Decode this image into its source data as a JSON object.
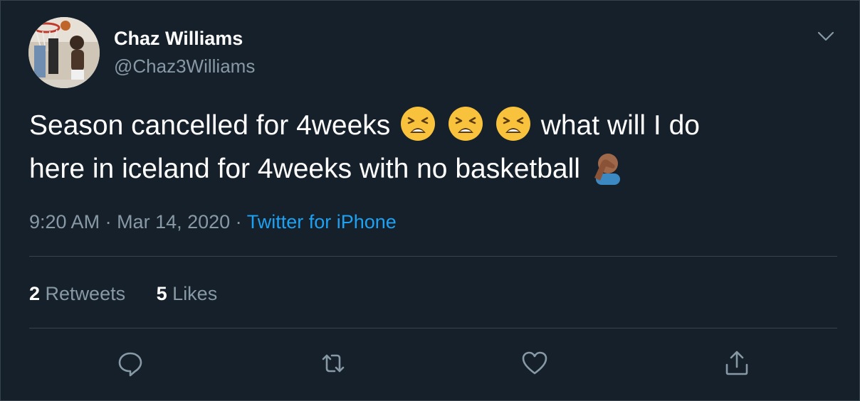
{
  "author": {
    "display_name": "Chaz Williams",
    "handle": "@Chaz3Williams",
    "avatar_icon": "avatar-photo"
  },
  "tweet": {
    "line1_part1": "Season cancelled for 4weeks",
    "line1_part2": "what will I do",
    "line2_part1": "here in iceland for 4weeks with no basketball",
    "emojis": [
      "weary-face-emoji",
      "weary-face-emoji",
      "weary-face-emoji",
      "face-palm-emoji"
    ]
  },
  "meta": {
    "time": "9:20 AM",
    "separator": " · ",
    "date": "Mar 14, 2020",
    "source": "Twitter for iPhone"
  },
  "stats": {
    "retweets_count": "2",
    "retweets_label": "Retweets",
    "likes_count": "5",
    "likes_label": "Likes"
  },
  "actions": [
    "reply-icon",
    "retweet-icon",
    "like-icon",
    "share-icon"
  ],
  "colors": {
    "background": "#15202b",
    "border": "#38444d",
    "secondary_text": "#8899a6",
    "link": "#1da1f2"
  }
}
